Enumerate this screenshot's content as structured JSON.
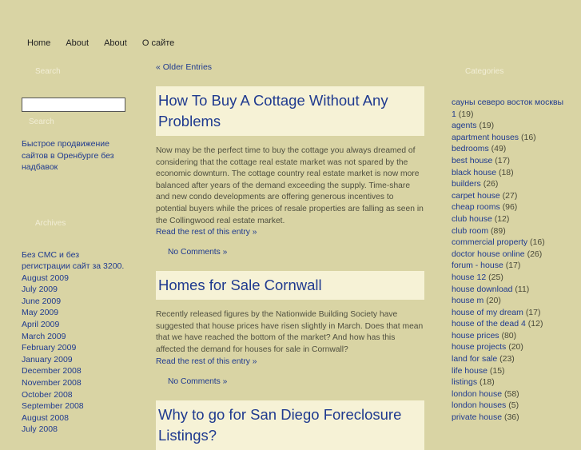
{
  "nav": [
    "Home",
    "About",
    "About",
    "О сайте"
  ],
  "sidebar_left": {
    "search_title": "Search",
    "search_button": "Search",
    "promo_link": "Быстрое продвижение сайтов в Оренбурге без надбавок",
    "archives_title": "Archives",
    "archives": [
      "Без СМС и без регистрации сайт за 3200.",
      "August 2009",
      "July 2009",
      "June 2009",
      "May 2009",
      "April 2009",
      "March 2009",
      "February 2009",
      "January 2009",
      "December 2008",
      "November 2008",
      "October 2008",
      "September 2008",
      "August 2008",
      "July 2008"
    ]
  },
  "main": {
    "older_entries": "« Older Entries",
    "posts": [
      {
        "title": "How To Buy A Cottage Without Any Problems",
        "body": "Now may be the perfect time to buy the cottage you always dreamed of considering that the cottage real estate market was not spared by the economic downturn. The cottage country real estate market is now more balanced after years of the demand exceeding the supply. Time-share and new condo developments are offering generous incentives to potential buyers while the prices of resale properties are falling as seen in the Collingwood real estate market.",
        "read_more": "Read the rest of this entry »",
        "comments": "No Comments »"
      },
      {
        "title": "Homes for Sale Cornwall",
        "body": "Recently released figures by the Nationwide Building Society have suggested that house prices have risen slightly in March. Does that mean that we have reached the bottom of the market? And how has this affected the demand for houses for sale in Cornwall?",
        "read_more": "Read the rest of this entry »",
        "comments": "No Comments »"
      },
      {
        "title": "Why to go for San Diego Foreclosure Listings?",
        "body": "",
        "read_more": "",
        "comments": ""
      }
    ]
  },
  "sidebar_right": {
    "categories_title": "Categories",
    "categories": [
      {
        "name": "сауны северо восток москвы",
        "count": ""
      },
      {
        "name": "1",
        "count": "(19)"
      },
      {
        "name": "agents",
        "count": "(19)"
      },
      {
        "name": "apartment houses",
        "count": "(16)"
      },
      {
        "name": "bedrooms",
        "count": "(49)"
      },
      {
        "name": "best house",
        "count": "(17)"
      },
      {
        "name": "black house",
        "count": "(18)"
      },
      {
        "name": "builders",
        "count": "(26)"
      },
      {
        "name": "carpet house",
        "count": "(27)"
      },
      {
        "name": "cheap rooms",
        "count": "(96)"
      },
      {
        "name": "club house",
        "count": "(12)"
      },
      {
        "name": "club room",
        "count": "(89)"
      },
      {
        "name": "commercial property",
        "count": "(16)"
      },
      {
        "name": "doctor house online",
        "count": "(26)"
      },
      {
        "name": "forum - house",
        "count": "(17)"
      },
      {
        "name": "house 12",
        "count": "(25)"
      },
      {
        "name": "house download",
        "count": "(11)"
      },
      {
        "name": "house m",
        "count": "(20)"
      },
      {
        "name": "house of my dream",
        "count": "(17)"
      },
      {
        "name": "house of the dead 4",
        "count": "(12)"
      },
      {
        "name": "house prices",
        "count": "(80)"
      },
      {
        "name": "house projects",
        "count": "(20)"
      },
      {
        "name": "land for sale",
        "count": "(23)"
      },
      {
        "name": "life house",
        "count": "(15)"
      },
      {
        "name": "listings",
        "count": "(18)"
      },
      {
        "name": "london house",
        "count": "(58)"
      },
      {
        "name": "london houses",
        "count": "(5)"
      },
      {
        "name": "private house",
        "count": "(36)"
      }
    ]
  }
}
